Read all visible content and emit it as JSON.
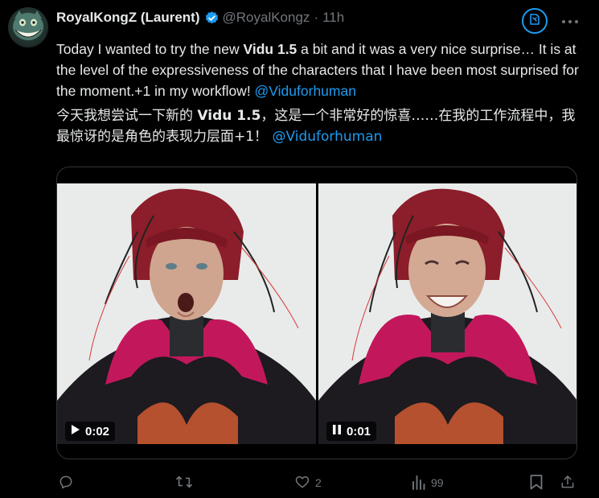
{
  "author": {
    "display_name": "RoyalKongZ (Laurent)",
    "handle": "@RoyalKongz",
    "separator": "·",
    "time": "11h"
  },
  "post": {
    "en": {
      "p1": "Today I wanted to try the new ",
      "bold": "Vidu 1.5",
      "p2": " a bit and it was a very nice surprise… It is at the level of the expressiveness of the characters that I have been most surprised for the moment.+1 in my workflow! ",
      "mention": "@Viduforhuman"
    },
    "zh": {
      "p1": "今天我想尝试一下新的 ",
      "bold": "Vidu 1.5",
      "p2": "，这是一个非常好的惊喜……在我的工作流程中，我最惊讶的是角色的表现力层面+1！",
      "mention": "@Viduforhuman"
    }
  },
  "media": {
    "videos": [
      {
        "state_icon": "play-icon",
        "time": "0:02"
      },
      {
        "state_icon": "pause-icon",
        "time": "0:01"
      }
    ]
  },
  "actions": {
    "reply_count": "",
    "repost_count": "",
    "like_count": "2",
    "views_count": "99"
  },
  "colors": {
    "accent": "#1d9bf0",
    "muted": "#71767b",
    "text": "#e7e9ea",
    "background": "#000000"
  }
}
